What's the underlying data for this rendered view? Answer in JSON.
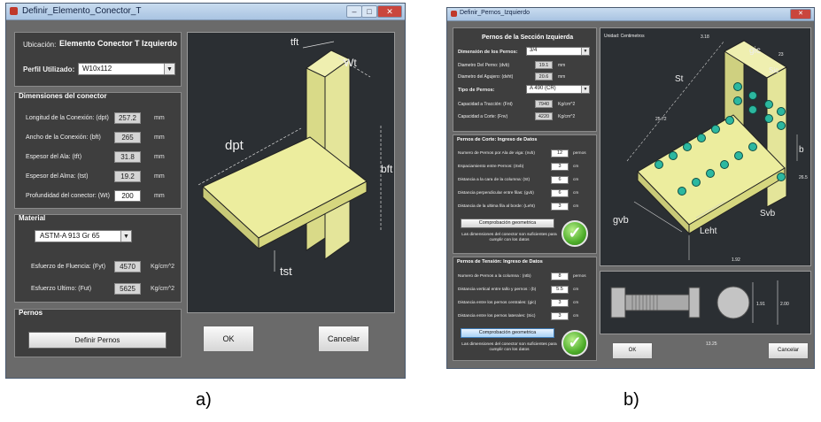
{
  "left_window": {
    "title": "Definir_Elemento_Conector_T",
    "ubicacion_label": "Ubicación:",
    "ubicacion_value": "Elemento Conector  T   Izquierdo",
    "perfil_label": "Perfil Utilizado:",
    "perfil_value": "W10x112",
    "dimensiones_header": "Dimensiones del conector",
    "dims": [
      {
        "label": "Longitud de la Conexión: (dpt)",
        "value": "257.2",
        "unit": "mm"
      },
      {
        "label": "Ancho de la Conexión: (bft)",
        "value": "265",
        "unit": "mm"
      },
      {
        "label": "Espesor del Ala: (tft)",
        "value": "31.8",
        "unit": "mm"
      },
      {
        "label": "Espesor del Alma: (tst)",
        "value": "19.2",
        "unit": "mm"
      },
      {
        "label": "Profundidad del conector: (Wt)",
        "value": "200",
        "unit": "mm"
      }
    ],
    "material_header": "Material",
    "material_value": "ASTM-A 913  Gr 65",
    "fyt_label": "Esfuerzo de Fluencia: (Fyt)",
    "fyt_value": "4570",
    "fyt_unit": "Kg/cm^2",
    "fut_label": "Esfuerzo Ultimo: (Fut)",
    "fut_value": "5625",
    "fut_unit": "Kg/cm^2",
    "pernos_header": "Pernos",
    "definir_pernos": "Definir Pernos",
    "ok": "OK",
    "cancelar": "Cancelar",
    "diagram_labels": {
      "tft": "tft",
      "wt": "Wt",
      "dpt": "dpt",
      "bft": "bft",
      "tst": "tst"
    }
  },
  "right_window": {
    "title": "Definir_Pernos_Izquierdo",
    "section_title": "Pernos de la Sección Izquierda",
    "dim_label": "Dimensión de los Pernos:",
    "dim_value": "3/4",
    "props": [
      {
        "label": "Diametro Del Perno: (dvb)",
        "value": "19.1",
        "unit": "mm"
      },
      {
        "label": "Diametro del Agujero: (dvht)",
        "value": "20.6",
        "unit": "mm"
      }
    ],
    "tipo_label": "Tipo de Pernos:",
    "tipo_value": "A 490 (CR)",
    "caps": [
      {
        "label": "Capacidad a Tracción: (Fnt)",
        "value": "7940",
        "unit": "Kg/cm^2"
      },
      {
        "label": "Capacidad a Corte: (Fnv)",
        "value": "4220",
        "unit": "Kg/cm^2"
      }
    ],
    "corte_header": "Pernos de Corte:   Ingreso de Datos",
    "corte_rows": [
      {
        "label": "Numero de Pernos por Ala de viga: (nvb)",
        "value": "12",
        "unit": "pernos"
      },
      {
        "label": "Espaciamiento entre Pernos: (Svb)",
        "value": "3",
        "unit": "cm"
      },
      {
        "label": "Distancia a la cara de la columna: (St)",
        "value": "6",
        "unit": "cm"
      },
      {
        "label": "Distancia perpendicular entre filas: (gvb)",
        "value": "6",
        "unit": "cm"
      },
      {
        "label": "Distancia de la ultima fila al borde: (Leht)",
        "value": "3",
        "unit": "cm"
      }
    ],
    "comprobacion": "Comprobación geometrica",
    "ok_message": "Las dimensiones del conector son suficientes para cumplir con los datos",
    "tension_header": "Pernos de Tensión:   Ingreso de Datos",
    "tension_rows": [
      {
        "label": "Numero de Pernos a la columna : (ntb)",
        "value": "8",
        "unit": "pernos"
      },
      {
        "label": "Distancia vertical entre tallo y pernos : (b)",
        "value": "5.5",
        "unit": "cm"
      },
      {
        "label": "Distancia entre los pernos centrales: (gic)",
        "value": "3",
        "unit": "cm"
      },
      {
        "label": "Distancia entre los pernos laterales: (Sic)",
        "value": "3",
        "unit": "cm"
      }
    ],
    "comprobacion2": "Comprobación geometrica",
    "ok_message2": "Las dimensiones del conector son suficientes para cumplir con los datos",
    "unidad": "Unidad: Centimetros",
    "diagram_labels": {
      "top": "3.18",
      "gic": "gic",
      "sic": "Sic",
      "n23": "23",
      "st": "St",
      "n2572": "25.72",
      "b": "b",
      "n265": "26.5",
      "svb": "Svb",
      "gvb": "gvb",
      "leht": "Leht",
      "n192": "1.92"
    },
    "bolt_dims": {
      "d1": "1.91",
      "d2": "2.00",
      "len": "13.25"
    },
    "ok": "OK",
    "cancelar": "Cancelar"
  },
  "captions": {
    "a": "a)",
    "b": "b)"
  },
  "colors": {
    "steel": "#e4e59a",
    "bolt": "#2cb8a0",
    "panel": "#3e3e3e",
    "drawing_bg": "#2b2f33"
  }
}
